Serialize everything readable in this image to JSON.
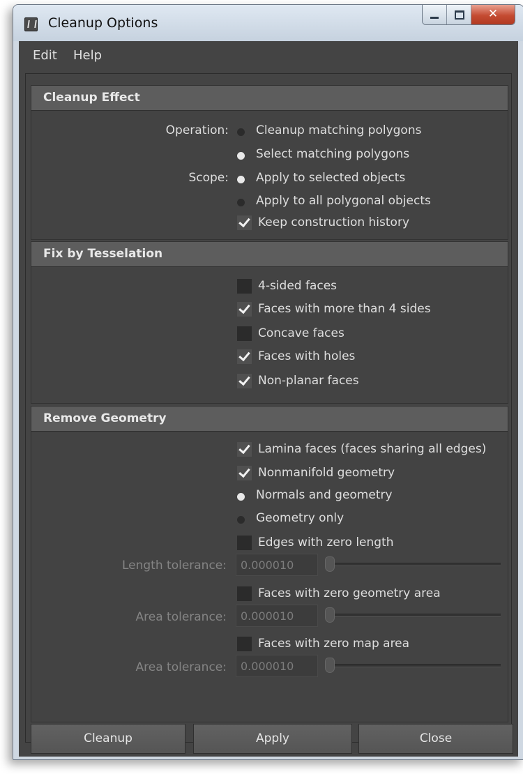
{
  "window": {
    "title": "Cleanup Options",
    "controls": {
      "minimize": "minimize",
      "maximize": "maximize",
      "close": "✕"
    }
  },
  "menu": [
    "Edit",
    "Help"
  ],
  "sections": {
    "cleanup_effect": {
      "title": "Cleanup Effect",
      "operation_label": "Operation:",
      "operation_options": [
        {
          "label": "Cleanup matching polygons",
          "selected": false
        },
        {
          "label": "Select matching polygons",
          "selected": true
        }
      ],
      "scope_label": "Scope:",
      "scope_options": [
        {
          "label": "Apply to selected objects",
          "selected": true
        },
        {
          "label": "Apply to all polygonal objects",
          "selected": false
        }
      ],
      "keep_history": {
        "label": "Keep construction history",
        "checked": true
      }
    },
    "fix_by_tesselation": {
      "title": "Fix by Tesselation",
      "options": [
        {
          "label": "4-sided faces",
          "checked": false
        },
        {
          "label": "Faces with more than 4 sides",
          "checked": true
        },
        {
          "label": "Concave faces",
          "checked": false
        },
        {
          "label": "Faces with holes",
          "checked": true
        },
        {
          "label": "Non-planar faces",
          "checked": true
        }
      ]
    },
    "remove_geometry": {
      "title": "Remove Geometry",
      "lamina": {
        "label": "Lamina faces (faces sharing all edges)",
        "checked": true
      },
      "nonmanifold": {
        "label": "Nonmanifold geometry",
        "checked": true
      },
      "nonmanifold_mode": [
        {
          "label": "Normals and geometry",
          "selected": true
        },
        {
          "label": "Geometry only",
          "selected": false
        }
      ],
      "zero_length": {
        "label": "Edges with zero length",
        "checked": false
      },
      "length_tolerance": {
        "label": "Length tolerance:",
        "value": "0.000010"
      },
      "zero_geom_area": {
        "label": "Faces with zero geometry area",
        "checked": false
      },
      "area_tolerance_1": {
        "label": "Area tolerance:",
        "value": "0.000010"
      },
      "zero_map_area": {
        "label": "Faces with zero map area",
        "checked": false
      },
      "area_tolerance_2": {
        "label": "Area tolerance:",
        "value": "0.000010"
      }
    }
  },
  "buttons": {
    "cleanup": "Cleanup",
    "apply": "Apply",
    "close": "Close"
  }
}
